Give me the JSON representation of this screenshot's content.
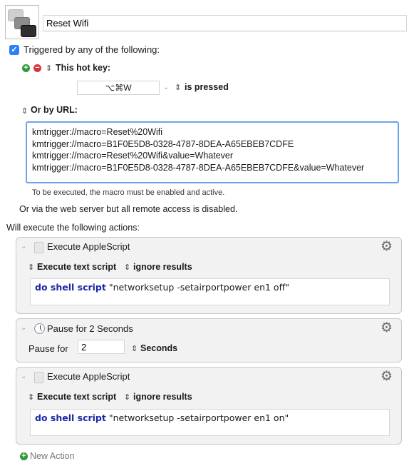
{
  "macro": {
    "name": "Reset Wifi",
    "icon": "keyboard-keys-icon"
  },
  "triggers": {
    "enabled": true,
    "header": "Triggered by any of the following:",
    "hotkey": {
      "label": "This hot key:",
      "value": "⌥⌘W",
      "condition": "is pressed"
    },
    "url": {
      "label": "Or by URL:",
      "lines": [
        "kmtrigger://macro=Reset%20Wifi",
        "kmtrigger://macro=B1F0E5D8-0328-4787-8DEA-A65EBEB7CDFE",
        "kmtrigger://macro=Reset%20Wifi&value=Whatever",
        "kmtrigger://macro=B1F0E5D8-0328-4787-8DEA-A65EBEB7CDFE&value=Whatever"
      ],
      "note": "To be executed, the macro must be enabled and active."
    },
    "web_server_note": "Or via the web server but all remote access is disabled."
  },
  "actions_header": "Will execute the following actions:",
  "actions": [
    {
      "title": "Execute AppleScript",
      "icon": "document-icon",
      "mode": "Execute text script",
      "result": "ignore results",
      "script_keyword": "do shell script",
      "script_rest": " \"networksetup -setairportpower en1 off\""
    },
    {
      "title": "Pause for 2 Seconds",
      "icon": "clock-icon",
      "pause_label": "Pause for",
      "pause_value": "2",
      "unit": "Seconds"
    },
    {
      "title": "Execute AppleScript",
      "icon": "document-icon",
      "mode": "Execute text script",
      "result": "ignore results",
      "script_keyword": "do shell script",
      "script_rest": " \"networksetup -setairportpower en1 on\""
    }
  ],
  "new_action_label": "New Action",
  "colors": {
    "accent": "#2d7ff9",
    "add_green": "#2b9a3a",
    "remove_red": "#d9343e",
    "keyword_blue": "#1c27a6"
  }
}
